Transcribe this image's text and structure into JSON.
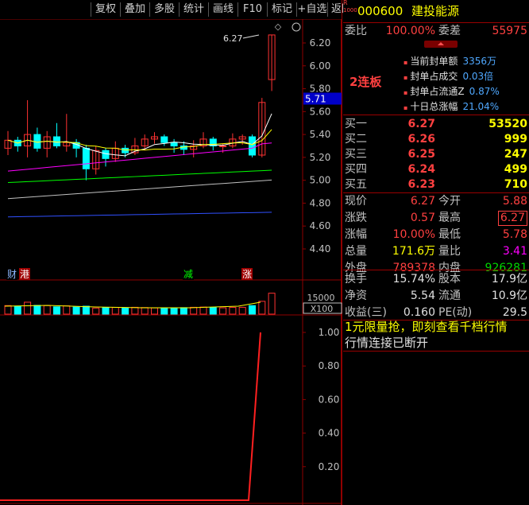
{
  "toolbar": {
    "buttons": [
      "复权",
      "叠加",
      "多股",
      "统计",
      "画线",
      "F10",
      "标记",
      "+自选",
      "返回"
    ]
  },
  "chart": {
    "price_ticks": [
      "6.20",
      "6.00",
      "5.80",
      "5.60",
      "5.40",
      "5.20",
      "5.00",
      "4.80",
      "4.60",
      "4.40"
    ],
    "current_price_tag": "5.71",
    "high_label": "6.27",
    "event_markers": [
      "财",
      "港",
      "减",
      "涨"
    ],
    "volume_ticks": [
      "15000",
      "X100"
    ],
    "indicator_ticks": [
      "1.00",
      "0.80",
      "0.60",
      "0.40",
      "0.20"
    ],
    "colors": {
      "up": "#ff3232",
      "down": "#00ffff",
      "ma5": "#ffffff",
      "ma10": "#ffff00",
      "ma20": "#ff00ff",
      "ma60": "#00ff00",
      "ma120": "#c0c0c0",
      "ma250": "#3050ff",
      "border": "#900000"
    }
  },
  "quote": {
    "code": "000600",
    "name": "建投能源",
    "rz_badge": "R",
    "rz_badge2": "1000",
    "weibi_label": "委比",
    "weibi_value": "100.00%",
    "weicha_label": "委差",
    "weicha_value": "55975",
    "board_tag": "2连板",
    "seal_info": [
      {
        "label": "当前封单额",
        "value": "3356万"
      },
      {
        "label": "封单占成交",
        "value": "0.03倍"
      },
      {
        "label": "封单占流通Z",
        "value": "0.87%"
      },
      {
        "label": "十日总涨幅",
        "value": "21.04%"
      }
    ],
    "bids": [
      {
        "label": "买一",
        "price": "6.27",
        "vol": "53520"
      },
      {
        "label": "买二",
        "price": "6.26",
        "vol": "999"
      },
      {
        "label": "买三",
        "price": "6.25",
        "vol": "247"
      },
      {
        "label": "买四",
        "price": "6.24",
        "vol": "499"
      },
      {
        "label": "买五",
        "price": "6.23",
        "vol": "710"
      }
    ],
    "stats": {
      "xianjia_label": "现价",
      "xianjia": "6.27",
      "jinkai_label": "今开",
      "jinkai": "5.88",
      "zhangdie_label": "涨跌",
      "zhangdie": "0.57",
      "zuigao_label": "最高",
      "zuigao": "6.27",
      "zhangfu_label": "涨幅",
      "zhangfu": "10.00%",
      "zuidi_label": "最低",
      "zuidi": "5.78",
      "zongliang_label": "总量",
      "zongliang": "171.6万",
      "liangbi_label": "量比",
      "liangbi": "3.41",
      "waipan_label": "外盘",
      "waipan": "789378",
      "neipan_label": "内盘",
      "neipan": "926281",
      "huanshou_label": "换手",
      "huanshou": "15.74%",
      "guben_label": "股本",
      "guben": "17.9亿",
      "jingzi_label": "净资",
      "jingzi": "5.54",
      "liutong_label": "流通",
      "liutong": "10.9亿",
      "shouyi_label": "收益(三)",
      "shouyi": "0.160",
      "pe_label": "PE(动)",
      "pe": "29.5"
    },
    "promo": "1元限量抢，即刻查看千档行情",
    "status": "行情连接已断开"
  }
}
